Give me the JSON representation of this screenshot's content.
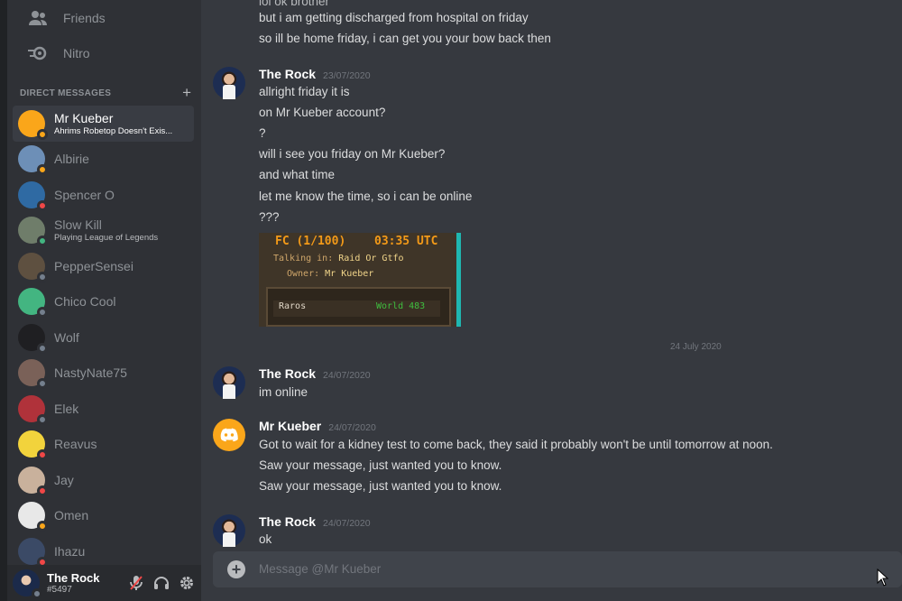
{
  "nav": {
    "friends_label": "Friends",
    "nitro_label": "Nitro"
  },
  "dm_header": {
    "title": "DIRECT MESSAGES",
    "add_icon": "plus-icon"
  },
  "dms": [
    {
      "name": "Mr Kueber",
      "sub": "Ahrims Robetop Doesn't Exis...",
      "active": true,
      "avatar_color": "#faa61a",
      "status_color": "#faa61a"
    },
    {
      "name": "Albirie",
      "sub": "",
      "avatar_color": "#6d8fb7",
      "status_color": "#faa61a"
    },
    {
      "name": "Spencer O",
      "sub": "",
      "avatar_color": "#2f6aa3",
      "status_color": "#f04747"
    },
    {
      "name": "Slow Kill",
      "sub": "Playing League of Legends",
      "avatar_color": "#6f7d6a",
      "status_color": "#43b581"
    },
    {
      "name": "PepperSensei",
      "sub": "",
      "avatar_color": "#5e5040",
      "status_color": "#747f8d"
    },
    {
      "name": "Chico Cool",
      "sub": "",
      "avatar_color": "#43b581",
      "status_color": "#747f8d"
    },
    {
      "name": "Wolf",
      "sub": "",
      "avatar_color": "#1f1f22",
      "status_color": "#747f8d"
    },
    {
      "name": "NastyNate75",
      "sub": "",
      "avatar_color": "#7a6158",
      "status_color": "#747f8d"
    },
    {
      "name": "Elek",
      "sub": "",
      "avatar_color": "#b0323a",
      "status_color": "#747f8d"
    },
    {
      "name": "Reavus",
      "sub": "",
      "avatar_color": "#f2d33c",
      "status_color": "#f04747"
    },
    {
      "name": "Jay",
      "sub": "",
      "avatar_color": "#c9b19c",
      "status_color": "#f04747"
    },
    {
      "name": "Omen",
      "sub": "",
      "avatar_color": "#e8e8e8",
      "status_color": "#faa61a"
    },
    {
      "name": "Ihazu",
      "sub": "",
      "avatar_color": "#3b4a66",
      "status_color": "#f04747"
    }
  ],
  "user": {
    "name": "The Rock",
    "tag": "#5497"
  },
  "messages": {
    "top_lines": [
      "but i am getting discharged from hospital on friday",
      "so ill be home friday, i can get you your bow back then"
    ],
    "group1": {
      "author": "The Rock",
      "timestamp": "23/07/2020",
      "lines": [
        "allright friday it is",
        "on Mr Kueber account?",
        "?",
        "will i see you friday on Mr Kueber?",
        "and what time",
        "let me know the time, so i can be online",
        "???"
      ],
      "image": {
        "fc_text": "FC (1/100)",
        "time_text": "03:35 UTC",
        "talking_label": "Talking in:",
        "talking_value": "Raid Or Gtfo",
        "owner_label": "Owner:",
        "owner_value": "Mr Kueber",
        "player": "Raros",
        "world": "World 483"
      }
    },
    "divider": "24 July 2020",
    "group2": {
      "author": "The Rock",
      "timestamp": "24/07/2020",
      "lines": [
        "im online"
      ]
    },
    "group3": {
      "author": "Mr Kueber",
      "timestamp": "24/07/2020",
      "lines": [
        "Got to wait for a kidney test to come back, they said it probably won't be until tomorrow at noon.",
        "Saw your message, just wanted you to know.",
        "Saw your message, just wanted you to know."
      ]
    },
    "group4": {
      "author": "The Rock",
      "timestamp": "24/07/2020",
      "lines": [
        "ok"
      ]
    }
  },
  "composer": {
    "placeholder": "Message @Mr Kueber"
  },
  "colors": {
    "background": "#36393f",
    "sidebar": "#2f3136",
    "user_panel": "#292b2f",
    "composer": "#40444b",
    "accent_orange": "#faa61a"
  }
}
